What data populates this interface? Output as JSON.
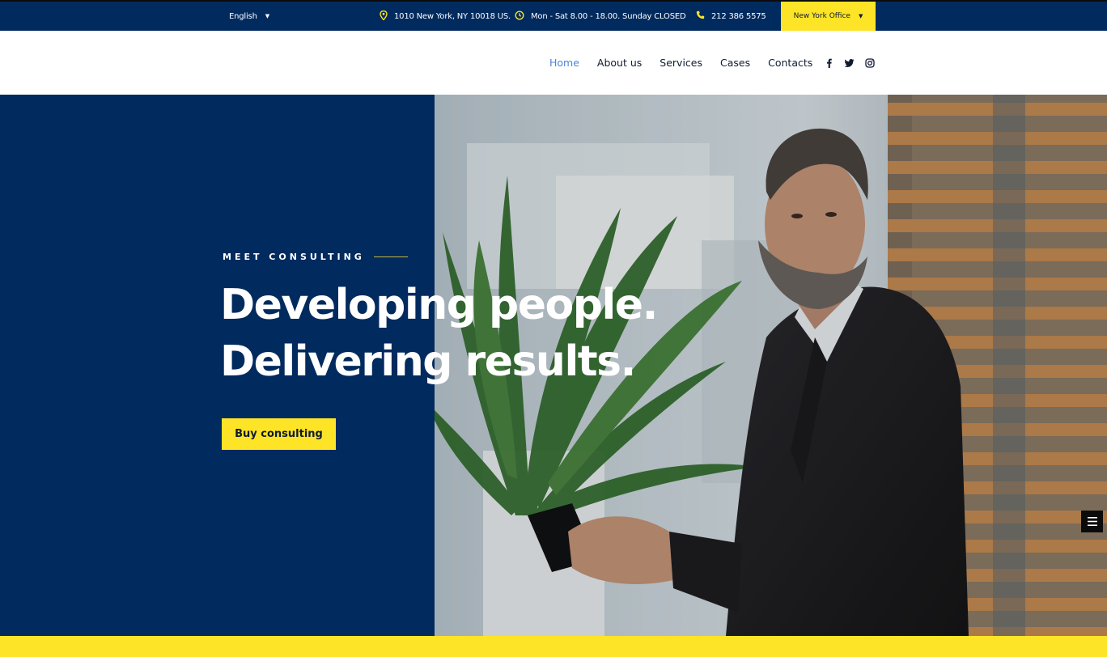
{
  "topbar": {
    "language": "English",
    "address": "1010 New York, NY 10018 US.",
    "hours": "Mon - Sat 8.00 - 18.00. Sunday CLOSED",
    "phone": "212 386 5575",
    "office": "New York Office",
    "accent_color": "#fde427",
    "background_color": "#012a5e"
  },
  "nav": {
    "items": [
      {
        "label": "Home",
        "active": true
      },
      {
        "label": "About us",
        "active": false
      },
      {
        "label": "Services",
        "active": false
      },
      {
        "label": "Cases",
        "active": false
      },
      {
        "label": "Contacts",
        "active": false
      }
    ],
    "social": [
      "facebook-icon",
      "twitter-icon",
      "instagram-icon"
    ]
  },
  "hero": {
    "eyebrow": "MEET CONSULTING",
    "headline_line1": "Developing people.",
    "headline_line2": "Delivering results.",
    "cta_label": "Buy consulting",
    "panel_color": "#012a5e"
  },
  "icons": {
    "menu_toggle": "menu-icon"
  }
}
